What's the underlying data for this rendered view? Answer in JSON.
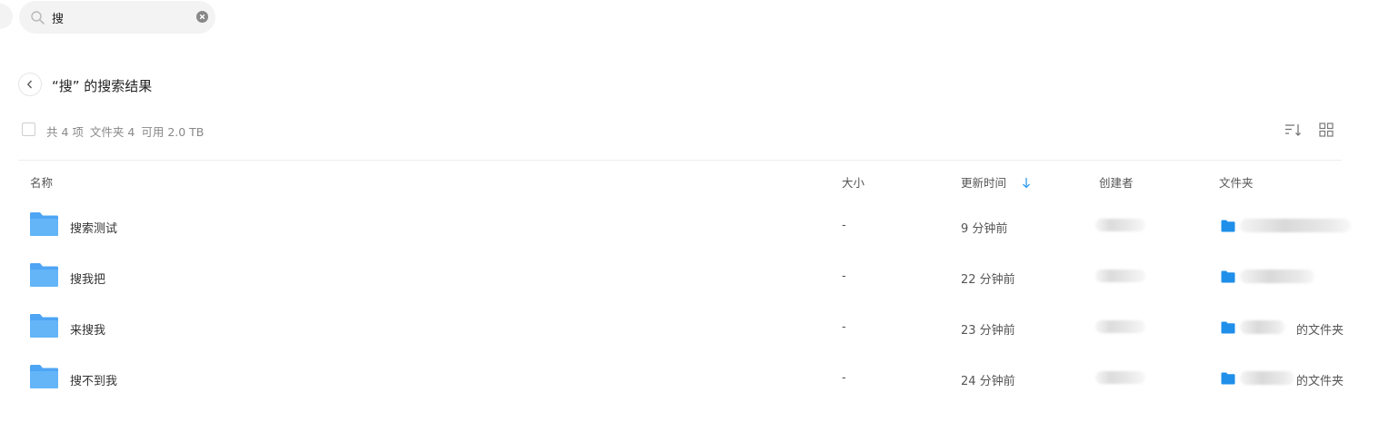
{
  "search": {
    "value": "搜",
    "placeholder": ""
  },
  "header": {
    "title": "“搜” 的搜索结果"
  },
  "summary": {
    "total": "共 4 项",
    "folders": "文件夹 4",
    "available": "可用 2.0 TB"
  },
  "columns": {
    "name": "名称",
    "size": "大小",
    "updated": "更新时间",
    "creator": "创建者",
    "folder": "文件夹"
  },
  "sort": {
    "column": "更新时间",
    "direction": "desc"
  },
  "colors": {
    "accent": "#2e9cf0",
    "folder": "#5aabf6",
    "folder_dark": "#1f8fea"
  },
  "rows": [
    {
      "name": "搜索测试",
      "size": "-",
      "updated": "9 分钟前",
      "location": ""
    },
    {
      "name": "搜我把",
      "size": "-",
      "updated": "22 分钟前",
      "location": ""
    },
    {
      "name": "来搜我",
      "size": "-",
      "updated": "23 分钟前",
      "location": "的文件夹"
    },
    {
      "name": "搜不到我",
      "size": "-",
      "updated": "24 分钟前",
      "location": "的文件夹"
    }
  ]
}
